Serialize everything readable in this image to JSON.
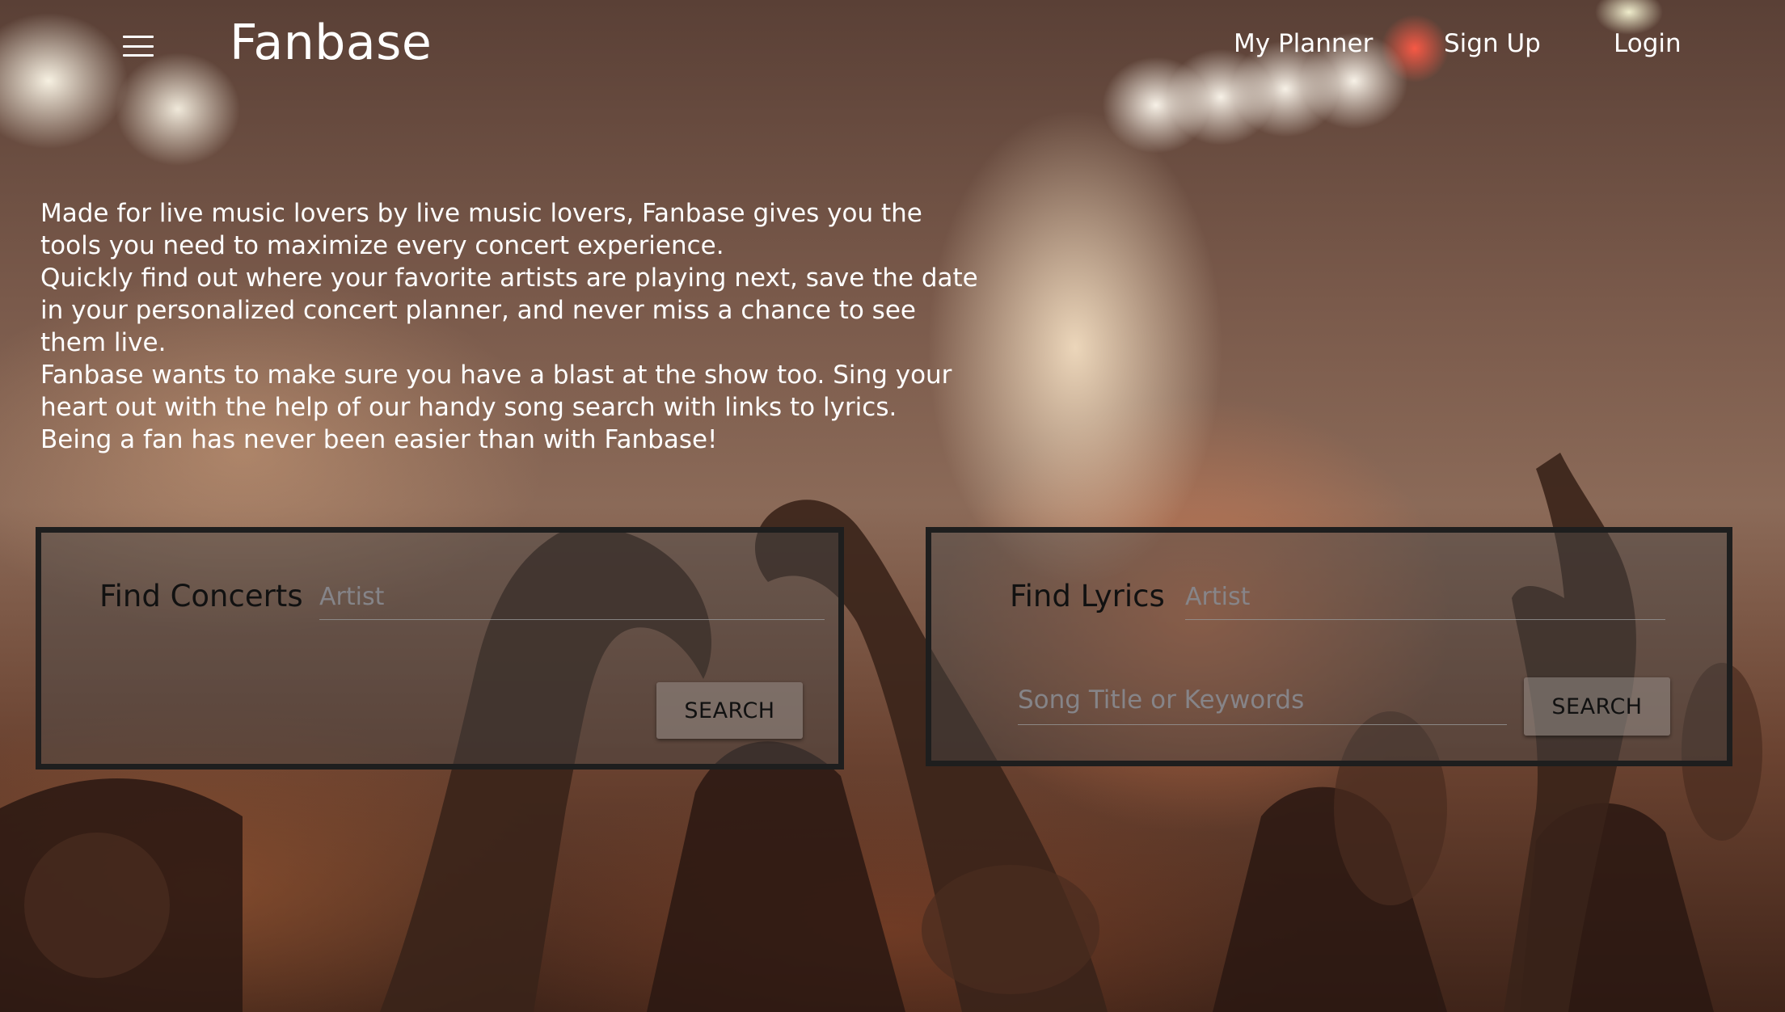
{
  "header": {
    "menu_icon": "hamburger-menu-icon",
    "brand": "Fanbase",
    "nav": {
      "planner": "My Planner",
      "signup": "Sign Up",
      "login": "Login"
    }
  },
  "intro": {
    "p1": "Made for live music lovers by live music lovers, Fanbase gives you the tools you need to maximize every concert experience.",
    "p2": "Quickly find out where your favorite artists are playing next, save the date in your personalized concert planner, and never miss a chance to see them live.",
    "p3": "Fanbase wants to make sure you have a blast at the show too. Sing your heart out with the help of our handy song search with links to lyrics.",
    "p4": "Being a fan has never been easier than with Fanbase!"
  },
  "concerts": {
    "title": "Find Concerts",
    "artist_placeholder": "Artist",
    "search_label": "SEARCH"
  },
  "lyrics": {
    "title": "Find Lyrics",
    "artist_placeholder": "Artist",
    "song_placeholder": "Song Title or Keywords",
    "search_label": "SEARCH"
  }
}
